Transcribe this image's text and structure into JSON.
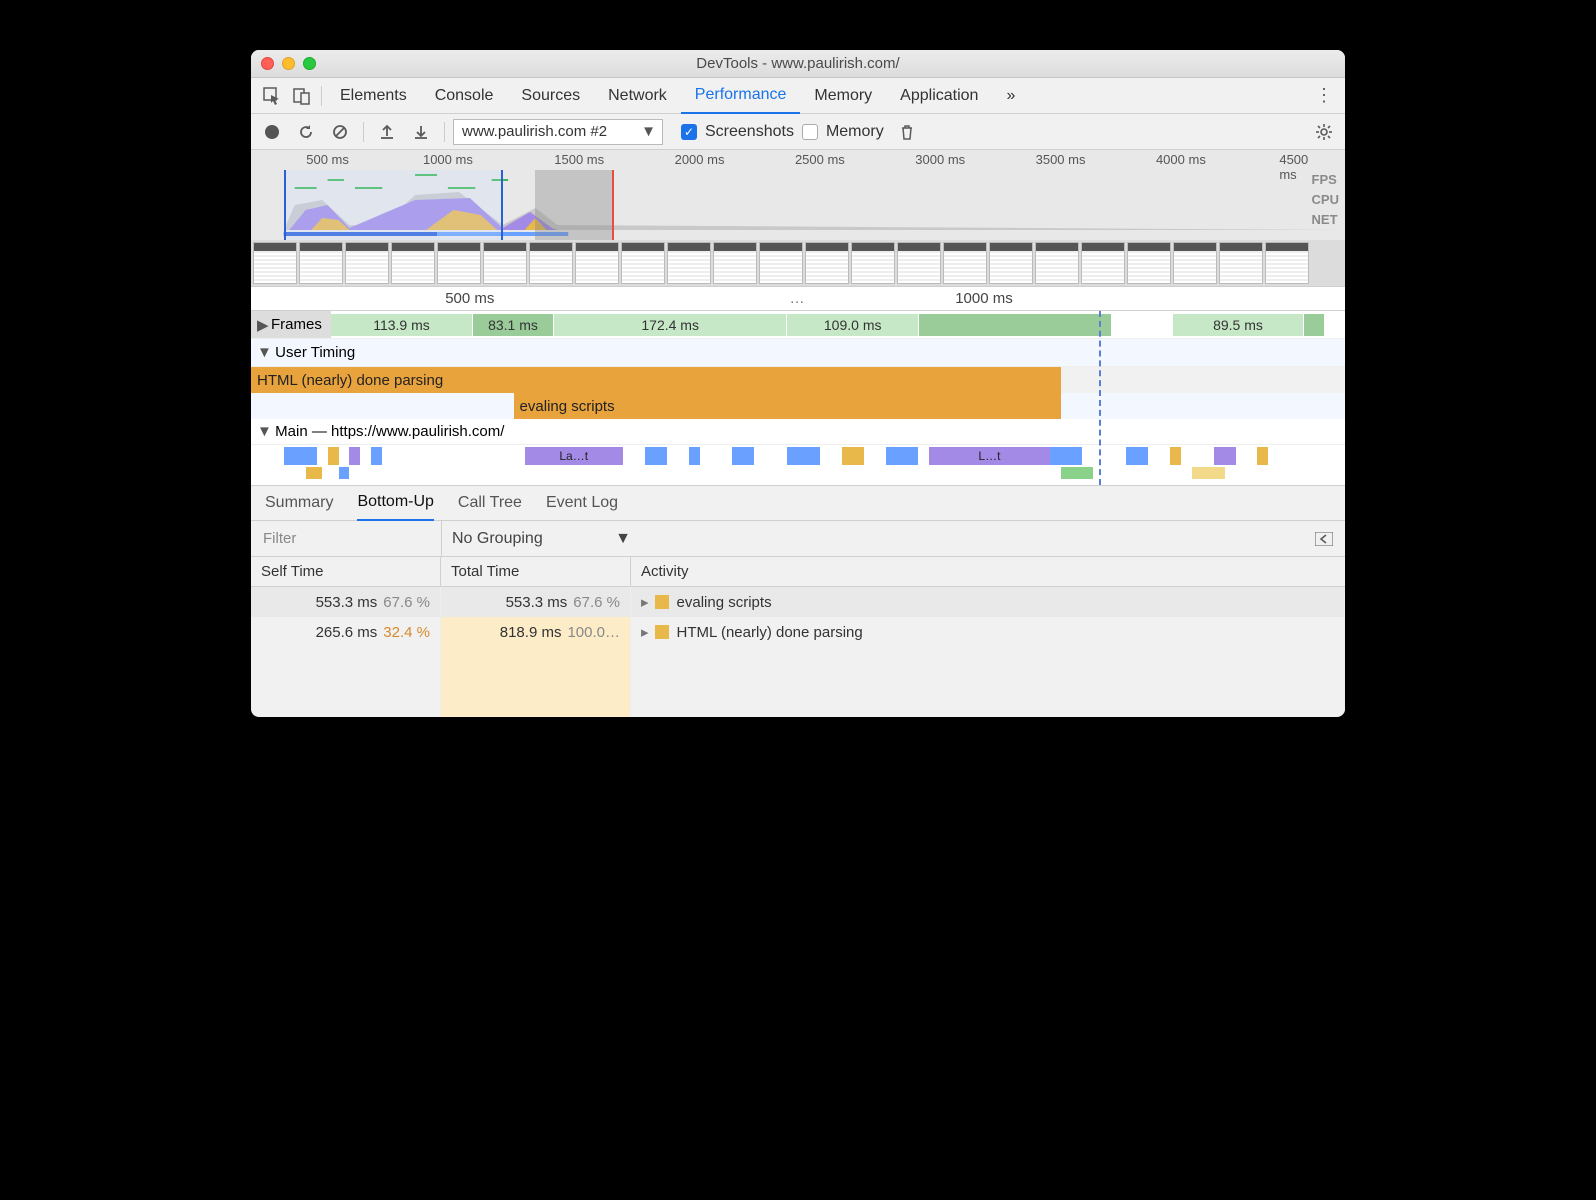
{
  "window": {
    "title": "DevTools - www.paulirish.com/"
  },
  "tabs": {
    "items": [
      "Elements",
      "Console",
      "Sources",
      "Network",
      "Performance",
      "Memory",
      "Application"
    ],
    "active": "Performance",
    "overflow": "»"
  },
  "toolbar": {
    "recording_select": "www.paulirish.com #2",
    "screenshots_label": "Screenshots",
    "screenshots_checked": true,
    "memory_label": "Memory",
    "memory_checked": false
  },
  "overview": {
    "ticks": [
      "500 ms",
      "1000 ms",
      "1500 ms",
      "2000 ms",
      "2500 ms",
      "3000 ms",
      "3500 ms",
      "4000 ms",
      "4500 ms"
    ],
    "right_labels": [
      "FPS",
      "CPU",
      "NET"
    ]
  },
  "ruler": {
    "ticks": [
      "500 ms",
      "1000 ms"
    ],
    "spacer": "…"
  },
  "frames": {
    "label": "Frames",
    "segments": [
      "113.9 ms",
      "83.1 ms",
      "172.4 ms",
      "109.0 ms",
      "89.5 ms"
    ]
  },
  "user_timing": {
    "label": "User Timing",
    "rows": [
      {
        "name": "HTML (nearly) done parsing"
      },
      {
        "name": "evaling scripts"
      }
    ]
  },
  "main": {
    "label": "Main — https://www.paulirish.com/",
    "chips": [
      "La…t",
      "L…t"
    ]
  },
  "subtabs": {
    "items": [
      "Summary",
      "Bottom-Up",
      "Call Tree",
      "Event Log"
    ],
    "active": "Bottom-Up"
  },
  "filter": {
    "placeholder": "Filter",
    "grouping": "No Grouping"
  },
  "table": {
    "headers": {
      "self": "Self Time",
      "total": "Total Time",
      "activity": "Activity"
    },
    "rows": [
      {
        "self_ms": "553.3 ms",
        "self_pct": "67.6 %",
        "total_ms": "553.3 ms",
        "total_pct": "67.6 %",
        "activity": "evaling scripts",
        "shade": false,
        "selected": true
      },
      {
        "self_ms": "265.6 ms",
        "self_pct": "32.4 %",
        "total_ms": "818.9 ms",
        "total_pct": "100.0…",
        "activity": "HTML (nearly) done parsing",
        "shade": true,
        "selected": false
      }
    ]
  }
}
